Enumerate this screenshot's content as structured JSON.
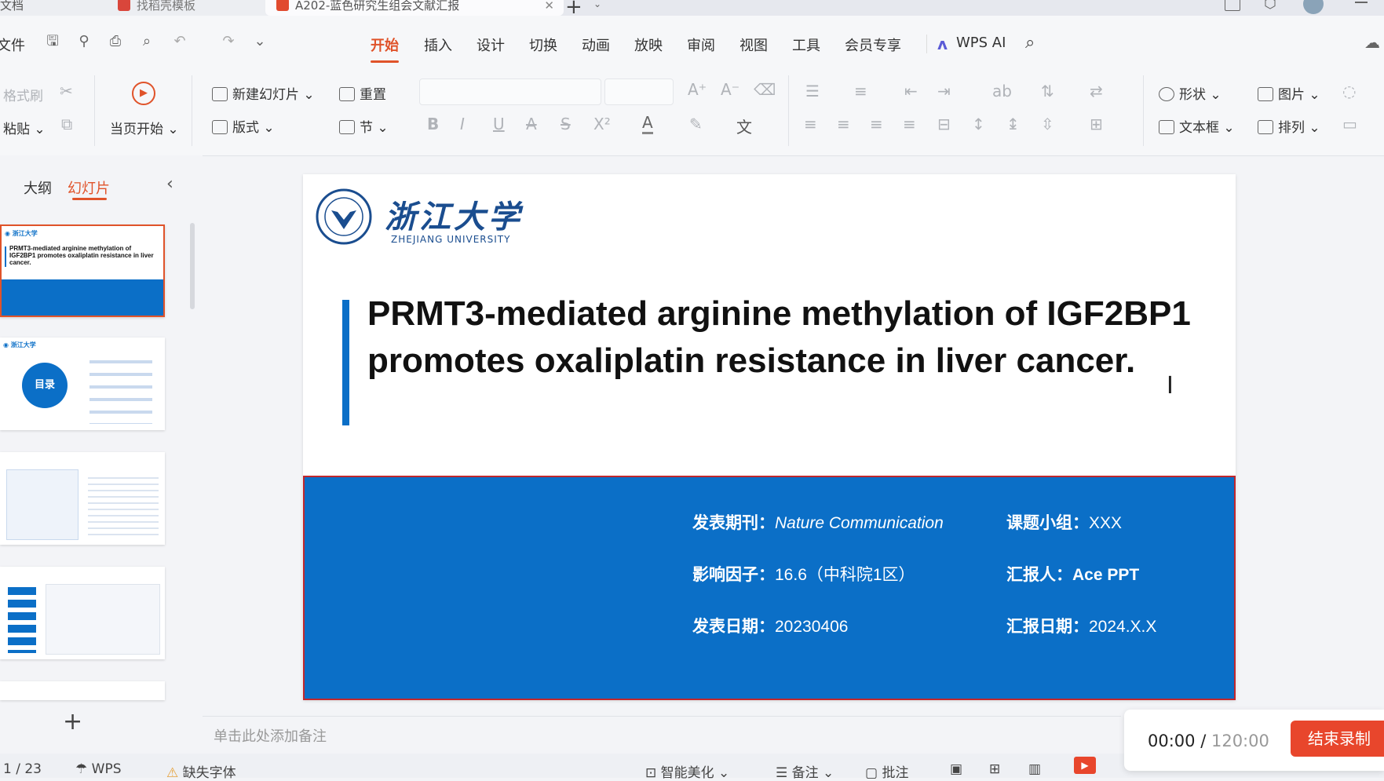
{
  "tabs": [
    {
      "label": "文档"
    },
    {
      "label": "找稻壳模板"
    },
    {
      "label": "A202-蓝色研究生组会文献汇报"
    }
  ],
  "menu": {
    "file": "文件",
    "items": [
      "开始",
      "插入",
      "设计",
      "切换",
      "动画",
      "放映",
      "审阅",
      "视图",
      "工具",
      "会员专享"
    ],
    "wps_ai": "WPS AI"
  },
  "ribbon": {
    "format_painter": "格式刷",
    "paste": "粘贴",
    "start_from_current": "当页开始",
    "new_slide": "新建幻灯片",
    "reset": "重置",
    "layout": "版式",
    "section": "节",
    "shape": "形状",
    "picture": "图片",
    "textbox": "文本框",
    "arrange": "排列"
  },
  "left_panel": {
    "tab_outline": "大纲",
    "tab_slides": "幻灯片",
    "thumb1_title": "PRMT3-mediated arginine methylation of IGF2BP1 promotes oxaliplatin resistance in liver cancer.",
    "thumb2_circle": "目录"
  },
  "slide": {
    "logo_cn": "浙江大学",
    "logo_en": "ZHEJIANG UNIVERSITY",
    "title": "PRMT3-mediated arginine methylation of IGF2BP1 promotes oxaliplatin resistance in liver cancer.",
    "journal_label": "发表期刊：",
    "journal_value": "Nature Communication",
    "if_label": "影响因子：",
    "if_value": "16.6（中科院1区）",
    "date_label": "发表日期：",
    "date_value": "20230406",
    "group_label": "课题小组：",
    "group_value": "XXX",
    "reporter_label": "汇报人：",
    "reporter_value": "Ace PPT",
    "report_date_label": "汇报日期：",
    "report_date_value": "2024.X.X"
  },
  "notes_placeholder": "单击此处添加备注",
  "status": {
    "page": "1 / 23",
    "wps": "WPS",
    "missing_font": "缺失字体",
    "smart": "智能美化",
    "notes": "备注",
    "comment": "批注"
  },
  "recording": {
    "elapsed": "00:00",
    "separator": " / ",
    "total": "120:00",
    "stop_label": "结束录制"
  },
  "colors": {
    "accent": "#e0532a",
    "slide_blue": "#0b6fc7",
    "record_red": "#e8462c"
  }
}
